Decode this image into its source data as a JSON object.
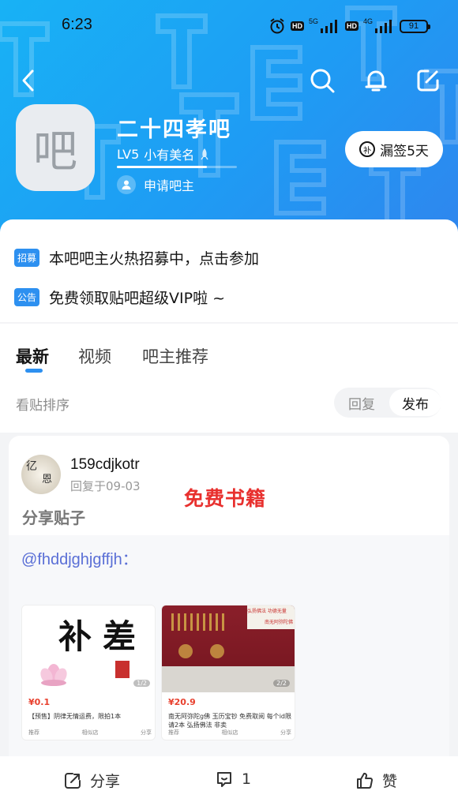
{
  "status_bar": {
    "time": "6:23",
    "net1": "5G",
    "net2": "4G",
    "hd": "HD",
    "battery": "91"
  },
  "forum": {
    "avatar_char": "吧",
    "name": "二十四孝吧",
    "level": "LV5",
    "title": "小有美名",
    "level_progress": 0.75,
    "apply_label": "申请吧主",
    "sign_icon_char": "补",
    "sign_label": "漏签5天"
  },
  "notices": [
    {
      "tag": "招募",
      "text": "本吧吧主火热招募中，点击参加"
    },
    {
      "tag": "公告",
      "text": "免费领取贴吧超级VIP啦 ~"
    }
  ],
  "tabs": [
    "最新",
    "视频",
    "吧主推荐"
  ],
  "sort": {
    "label": "看贴排序",
    "options": [
      "回复",
      "发布"
    ],
    "active": "发布"
  },
  "post": {
    "username": "159cdjkotr",
    "reply_time": "回复于09-03",
    "overlay_text": "免费书籍",
    "title": "分享贴子",
    "mention": "@fhddjghjgffjh：",
    "thumbs": [
      {
        "calligraphy": "补差",
        "count": "1/2",
        "price": "¥0.1",
        "desc": "【预售】阴律无情运费，限拍1本",
        "actions": [
          "推荐",
          "相似店",
          "分享"
        ]
      },
      {
        "banner_left": "弘扬佛法 功德无量",
        "banner_right": "南无阿弥陀佛",
        "count": "2/2",
        "price": "¥20.9",
        "desc": "南无阿弥陀g佛 玉历宝钞 免费取阅 每个id限请2本 弘扬佛法 非卖",
        "actions": [
          "推荐",
          "相似店",
          "分享"
        ]
      }
    ]
  },
  "actions": {
    "share": "分享",
    "comment_count": "1",
    "like": "赞"
  },
  "colors": {
    "brand_blue": "#2d90f0",
    "header_gradient_start": "#18b2f5",
    "header_gradient_end": "#2f86ee",
    "overlay_red": "#e8302e"
  }
}
